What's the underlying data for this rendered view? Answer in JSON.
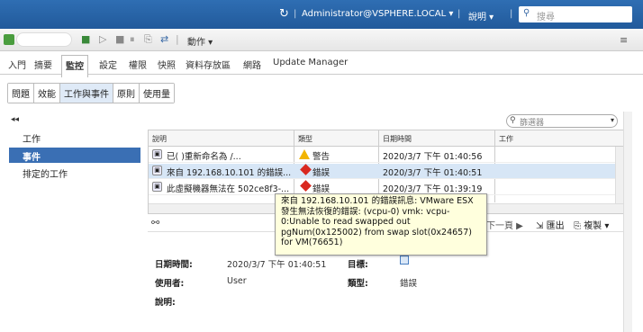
{
  "header": {
    "refresh_icon": "refresh-icon",
    "user_menu": "Administrator@VSPHERE.LOCAL ▾",
    "help_menu": "說明 ▾",
    "search_placeholder": "搜尋"
  },
  "toolbar": {
    "actions_label": "動作 ▾"
  },
  "tabs": [
    "入門",
    "摘要",
    "監控",
    "設定",
    "權限",
    "快照",
    "資料存放區",
    "網路",
    "Update Manager"
  ],
  "active_tab": "監控",
  "subtabs": [
    "問題",
    "效能",
    "工作與事件",
    "原則",
    "使用量"
  ],
  "active_subtab": "工作與事件",
  "nav": {
    "collapse": "◂◂",
    "items": [
      "工作",
      "事件",
      "排定的工作"
    ],
    "active": "事件"
  },
  "filter": {
    "placeholder": "篩選器"
  },
  "grid": {
    "columns": [
      "說明",
      "類型",
      "日期時間",
      "工作"
    ],
    "rows": [
      {
        "description": "已(          )重新命名為 /...",
        "type": "警告",
        "time": "2020/3/7 下午 01:40:56",
        "task": "",
        "level": "warning"
      },
      {
        "description": "來自 192.168.10.101 的錯誤...",
        "type": "錯誤",
        "time": "2020/3/7 下午 01:40:51",
        "task": "",
        "level": "error"
      },
      {
        "description": "此虛擬機器無法在 502ce8f3-...",
        "type": "錯誤",
        "time": "2020/3/7 下午 01:39:19",
        "task": "",
        "level": "error"
      }
    ]
  },
  "pager": {
    "next_page": "下一頁 ▶",
    "export": "匯出",
    "copy": "複製 ▾"
  },
  "detail": {
    "datetime_label": "日期時間:",
    "datetime_value": "2020/3/7 下午 01:40:51",
    "target_label": "目標:",
    "user_label": "使用者:",
    "user_value": "User",
    "type_label": "類型:",
    "type_value": "錯誤",
    "desc_label": "說明:"
  },
  "tooltip": "來自 192.168.10.101 的錯誤訊息: VMware ESX\n發生無法恢復的錯誤: (vcpu-0) vmk: vcpu-\n0:Unable to read swapped out\npgNum(0x125002) from swap slot(0x24657)\nfor VM(76651)",
  "colors": {
    "header": "#2f6eb3",
    "nav_active": "#3a6fb4",
    "row_selected": "#d7e6f6"
  }
}
